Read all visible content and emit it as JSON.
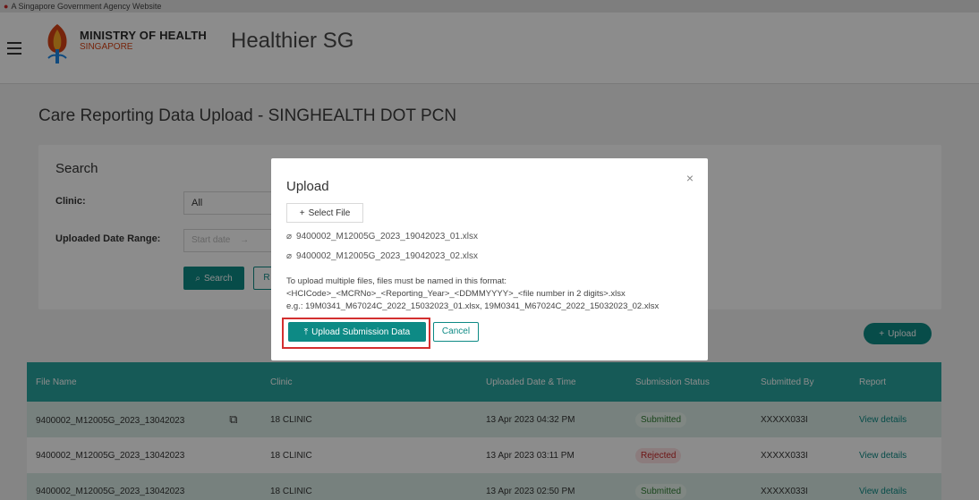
{
  "gov_banner": {
    "text": "A Singapore Government Agency Website"
  },
  "header": {
    "moh_line1": "MINISTRY OF HEALTH",
    "moh_line2": "SINGAPORE",
    "app_title": "Healthier SG"
  },
  "page_title": "Care Reporting Data Upload - SINGHEALTH DOT PCN",
  "search": {
    "title": "Search",
    "clinic_label": "Clinic:",
    "clinic_value": "All",
    "date_label": "Uploaded Date Range:",
    "date_placeholder": "Start date",
    "date_arrow": "→",
    "search_button": "Search",
    "reset_button": "R"
  },
  "upload_button": "Upload",
  "table": {
    "columns": [
      "File Name",
      "Clinic",
      "Uploaded Date & Time",
      "Submission Status",
      "Submitted By",
      "Report"
    ],
    "rows": [
      {
        "file": "9400002_M12005G_2023_13042023",
        "clinic": "18 CLINIC",
        "datetime": "13 Apr 2023 04:32 PM",
        "status": "Submitted",
        "by": "XXXXX033I",
        "report": "View details"
      },
      {
        "file": "9400002_M12005G_2023_13042023",
        "clinic": "18 CLINIC",
        "datetime": "13 Apr 2023 03:11 PM",
        "status": "Rejected",
        "by": "XXXXX033I",
        "report": "View details"
      },
      {
        "file": "9400002_M12005G_2023_13042023",
        "clinic": "18 CLINIC",
        "datetime": "13 Apr 2023 02:50 PM",
        "status": "Submitted",
        "by": "XXXXX033I",
        "report": "View details"
      }
    ]
  },
  "modal": {
    "title": "Upload",
    "close": "×",
    "select_file": "Select File",
    "files": [
      "9400002_M12005G_2023_19042023_01.xlsx",
      "9400002_M12005G_2023_19042023_02.xlsx"
    ],
    "note_line1": "To upload multiple files, files must be named in this format:",
    "note_line2": "<HCICode>_<MCRNo>_<Reporting_Year>_<DDMMYYYY>_<file number in 2 digits>.xlsx",
    "note_line3": "e.g.: 19M0341_M67024C_2022_15032023_01.xlsx, 19M0341_M67024C_2022_15032023_02.xlsx",
    "submit_button": "Upload Submission Data",
    "cancel_button": "Cancel"
  },
  "colors": {
    "accent": "#0d8a85",
    "table_header": "#28a49e",
    "highlight": "#d32f2f"
  }
}
